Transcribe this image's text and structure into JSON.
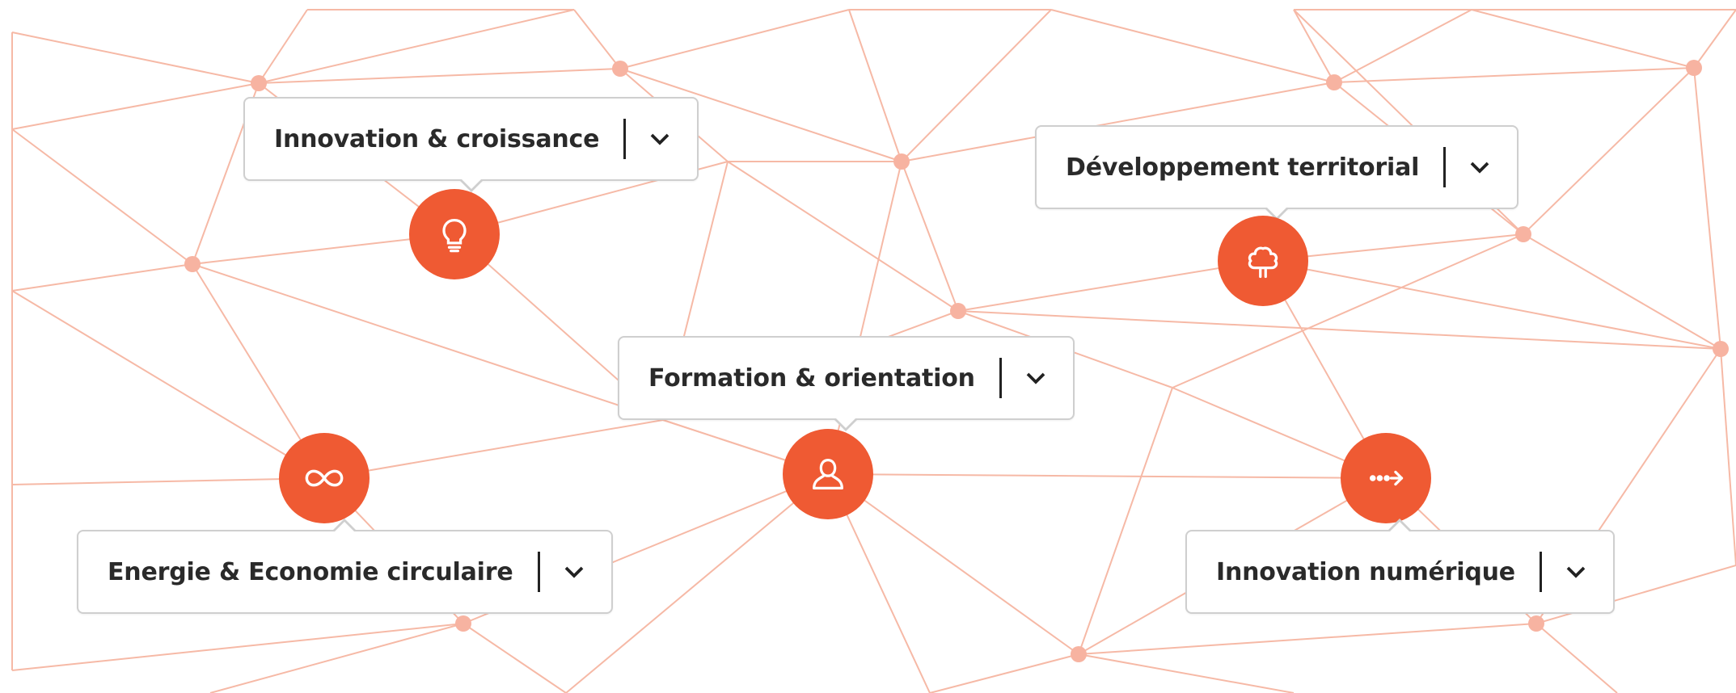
{
  "colors": {
    "accent": "#ef5a33",
    "network_line": "#f6b9a6",
    "network_dot": "#f7b3a1"
  },
  "topics": [
    {
      "label": "Innovation & croissance",
      "icon": "lightbulb-icon"
    },
    {
      "label": "Développement territorial",
      "icon": "tree-icon"
    },
    {
      "label": "Formation & orientation",
      "icon": "person-icon"
    },
    {
      "label": "Energie & Economie circulaire",
      "icon": "infinity-icon"
    },
    {
      "label": "Innovation numérique",
      "icon": "dots-arrow-icon"
    }
  ]
}
